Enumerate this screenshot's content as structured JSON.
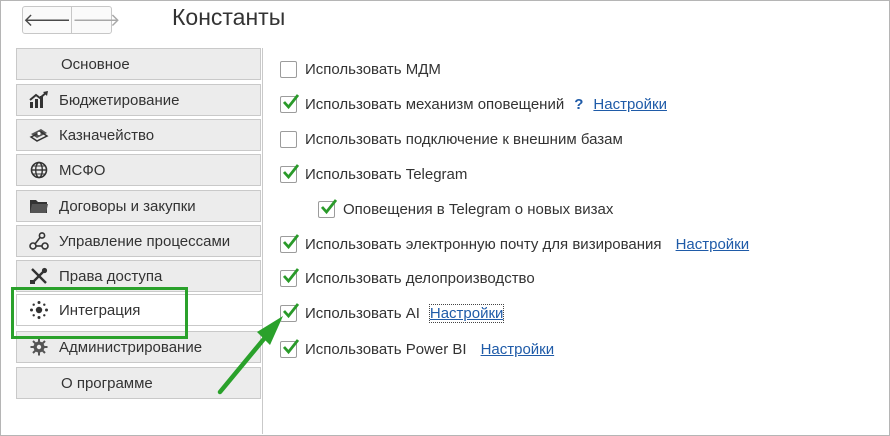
{
  "window": {
    "title": "Константы",
    "back_icon": "arrow-left-icon",
    "forward_icon": "arrow-right-icon",
    "back_glyph": "🡐",
    "forward_glyph": "🡒"
  },
  "sidebar": {
    "items": [
      {
        "label": "Основное",
        "icon": ""
      },
      {
        "label": "Бюджетирование",
        "icon": "chart-up-icon"
      },
      {
        "label": "Казначейство",
        "icon": "money-stack-icon"
      },
      {
        "label": "МСФО",
        "icon": "globe-icon"
      },
      {
        "label": "Договоры и закупки",
        "icon": "folder-icon"
      },
      {
        "label": "Управление процессами",
        "icon": "process-flow-icon"
      },
      {
        "label": "Права доступа",
        "icon": "tools-icon"
      },
      {
        "label": "Интеграция",
        "icon": "integration-icon",
        "active": true
      },
      {
        "label": "Администрирование",
        "icon": "gear-icon"
      },
      {
        "label": "О программе",
        "icon": ""
      }
    ]
  },
  "options": [
    {
      "label": "Использовать МДМ",
      "checked": false
    },
    {
      "label": "Использовать механизм оповещений",
      "checked": true,
      "help": "?",
      "link": "Настройки"
    },
    {
      "label": "Использовать подключение к внешним базам",
      "checked": false
    },
    {
      "label": "Использовать Telegram",
      "checked": true
    },
    {
      "label": "Оповещения в Telegram о новых визах",
      "checked": true,
      "indent": true
    },
    {
      "label": "Использовать электронную почту для визирования",
      "checked": true,
      "link": "Настройки"
    },
    {
      "label": "Использовать делопроизводство",
      "checked": true
    },
    {
      "label": "Использовать AI",
      "checked": true,
      "link": "Настройки",
      "focused": true
    },
    {
      "label": "Использовать Power BI",
      "checked": true,
      "link": "Настройки"
    }
  ],
  "colors": {
    "check": "#2a9a2a",
    "link": "#1f5ba8",
    "highlight": "#2aa12b",
    "arrow": "#2aa12b"
  }
}
